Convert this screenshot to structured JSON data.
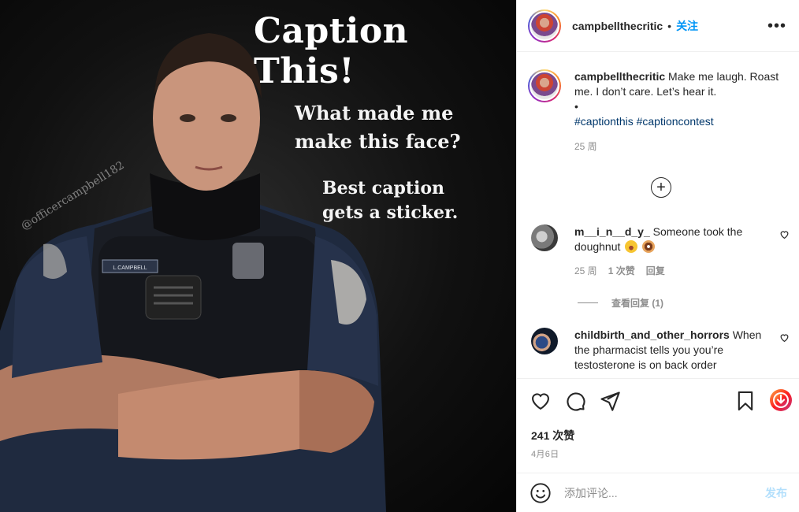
{
  "post_image": {
    "title": "Caption This!",
    "line1": "What made me",
    "line2": "make this face?",
    "line3": "Best caption",
    "line4": "gets a sticker.",
    "watermark": "@officercampbell182",
    "badge_text": "L.CAMPBELL"
  },
  "header": {
    "username": "campbellthecritic",
    "separator": "•",
    "follow_label": "关注",
    "more_label": "•••"
  },
  "caption": {
    "username": "campbellthecritic",
    "text": "Make me laugh. Roast me. I don’t care. Let’s hear it.",
    "bullet": "•",
    "hashtag1": "#captionthis",
    "hashtag2": "#captioncontest",
    "time": "25 周"
  },
  "comments": [
    {
      "username": "m__i_n__d_y_",
      "text": "Someone took the doughnut",
      "time": "25 周",
      "likes": "1 次赞",
      "reply_label": "回复",
      "view_replies": "查看回复 (1)"
    },
    {
      "username": "childbirth_and_other_horrors",
      "text": "When the pharmacist tells you you’re testosterone is on back order"
    }
  ],
  "actions": {
    "likes": "241 次赞",
    "date": "4月6日"
  },
  "add_comment": {
    "placeholder": "添加评论...",
    "post_label": "发布"
  },
  "colors": {
    "link_blue": "#0095f6",
    "hashtag": "#00376b",
    "muted": "#8e8e8e",
    "post_disabled": "#b2dffc"
  }
}
